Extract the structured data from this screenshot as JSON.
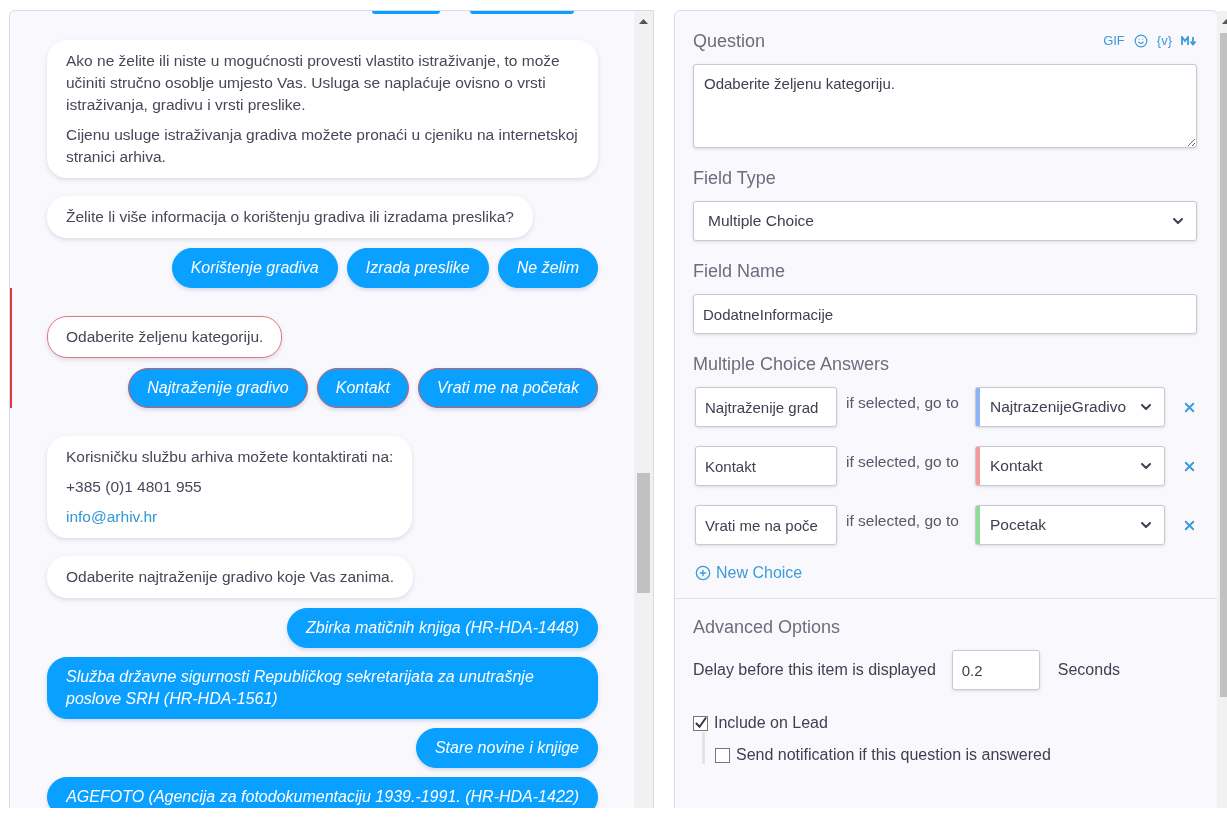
{
  "chat": [
    {
      "kind": "cut_choices",
      "selected": false
    },
    {
      "kind": "bot",
      "selected": false,
      "lines": [
        {
          "kind": "text",
          "text": "Ako ne želite ili niste u mogućnosti provesti vlastito istraživanje, to može učiniti stručno osoblje umjesto Vas. Usluga se naplaćuje ovisno o vrsti istraživanja, gradivu i vrsti preslike."
        },
        {
          "kind": "text",
          "text": "Cijenu usluge istraživanja gradiva možete pronaći u cjeniku na internetskoj stranici arhiva."
        }
      ]
    },
    {
      "kind": "bot",
      "selected": false,
      "lines": [
        {
          "kind": "text",
          "text": "Želite li više informacija o korištenju gradiva ili izradama preslika?"
        }
      ]
    },
    {
      "kind": "choices",
      "selected": false,
      "buttons": [
        "Korištenje gradiva",
        "Izrada preslike",
        "Ne želim"
      ]
    },
    {
      "kind": "bot",
      "selected": true,
      "lines": [
        {
          "kind": "text",
          "text": "Odaberite željenu kategoriju."
        }
      ]
    },
    {
      "kind": "choices",
      "selected": true,
      "buttons": [
        "Najtraženije gradivo",
        "Kontakt",
        "Vrati me na početak"
      ]
    },
    {
      "kind": "bot",
      "selected": false,
      "lines": [
        {
          "kind": "text",
          "text": "Korisničku službu arhiva možete kontaktirati na:"
        },
        {
          "kind": "text",
          "text": "+385 (0)1 4801 955"
        },
        {
          "kind": "link",
          "text": "info@arhiv.hr"
        }
      ]
    },
    {
      "kind": "bot",
      "selected": false,
      "lines": [
        {
          "kind": "text",
          "text": "Odaberite najtraženije gradivo koje Vas zanima."
        }
      ]
    },
    {
      "kind": "choices",
      "selected": false,
      "buttons": [
        "Zbirka matičnih knjiga (HR-HDA-1448)"
      ]
    },
    {
      "kind": "choices",
      "selected": false,
      "buttons": [
        "Služba državne sigurnosti Republičkog sekretarijata za unutrašnje poslove SRH (HR-HDA-1561)"
      ]
    },
    {
      "kind": "choices",
      "selected": false,
      "buttons": [
        "Stare novine i knjige"
      ]
    },
    {
      "kind": "choices",
      "selected": false,
      "buttons": [
        "AGEFOTO (Agencija za fotodokumentaciju 1939.-1991. (HR-HDA-1422)"
      ]
    }
  ],
  "editor": {
    "question": {
      "label": "Question",
      "tools": [
        {
          "kind": "text",
          "text": "GIF"
        },
        {
          "kind": "emoji"
        },
        {
          "kind": "text",
          "text": "{v}"
        },
        {
          "kind": "markdown"
        }
      ],
      "value": "Odaberite željenu kategoriju."
    },
    "field_type": {
      "label": "Field Type",
      "value": "Multiple Choice"
    },
    "field_name": {
      "label": "Field Name",
      "value": "DodatneInformacije"
    },
    "answers": {
      "label": "Multiple Choice Answers",
      "rows": [
        {
          "answer": "Najtraženije grad",
          "connector": "if selected, go to",
          "target": "NajtrazenijeGradivo",
          "color": "#8fb3f7"
        },
        {
          "answer": "Kontakt",
          "connector": "if selected, go to",
          "target": "Kontakt",
          "color": "#f59a9a"
        },
        {
          "answer": "Vrati me na poče",
          "connector": "if selected, go to",
          "target": "Pocetak",
          "color": "#8ddc9c"
        }
      ],
      "new_choice": "New Choice"
    },
    "advanced": {
      "label": "Advanced Options",
      "delay_label": "Delay before this item is displayed",
      "delay_value": "0.2",
      "delay_unit": "Seconds",
      "options": [
        {
          "label": "Include on Lead",
          "checked": true,
          "children": [
            {
              "label": "Send notification if this question is answered",
              "checked": false
            }
          ]
        }
      ]
    }
  }
}
